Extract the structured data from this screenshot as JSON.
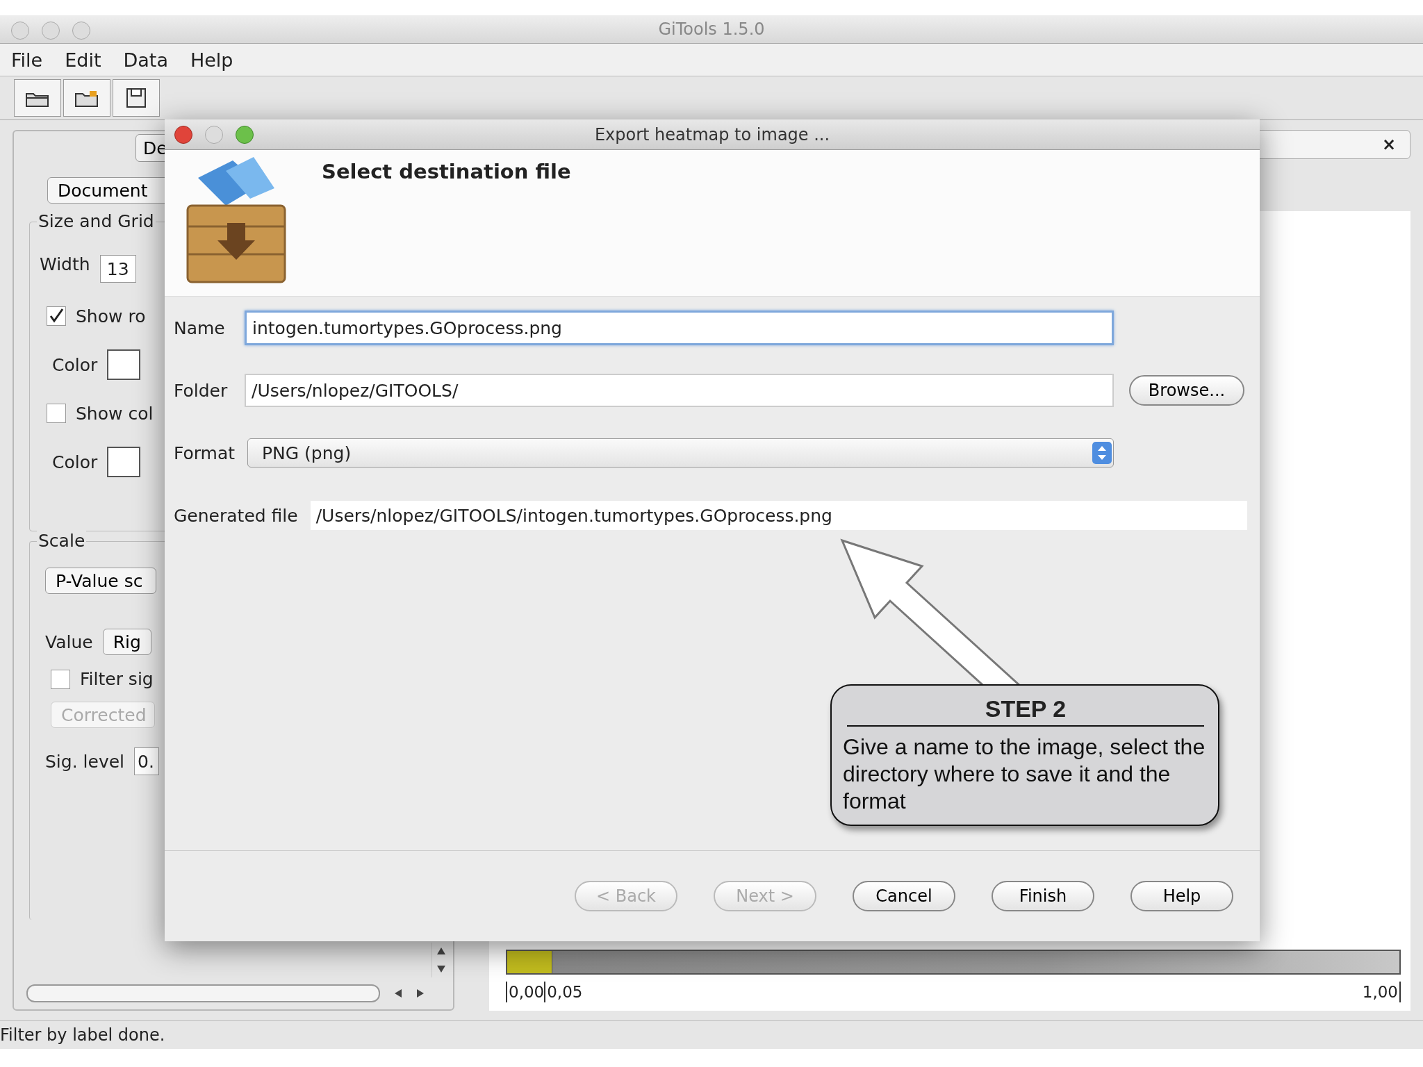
{
  "window": {
    "title": "GiTools 1.5.0"
  },
  "menu": [
    "File",
    "Edit",
    "Data",
    "Help"
  ],
  "left_panel": {
    "tab": "De",
    "document_button": "Document",
    "size_group": {
      "title": "Size and Grid",
      "width_label": "Width",
      "width_value": "13",
      "rows": [
        {
          "kind": "checkbox",
          "label": "Show ro",
          "checked": true
        },
        {
          "kind": "color",
          "label": "Color"
        },
        {
          "kind": "checkbox",
          "label": "Show col",
          "checked": false
        },
        {
          "kind": "color",
          "label": "Color"
        }
      ]
    },
    "scale_group": {
      "title": "Scale",
      "scale_button": "P-Value sc",
      "value_label": "Value",
      "value_button": "Rig",
      "filter": {
        "label": "Filter sig",
        "checked": false
      },
      "corrected_button": {
        "label": "Corrected",
        "disabled": true
      },
      "sig_label": "Sig. level",
      "sig_value": "0."
    }
  },
  "heatmap_panel": {
    "close": "×",
    "scale_labels": [
      "0,00",
      "0,05",
      "1,00"
    ]
  },
  "dialog": {
    "title": "Export heatmap to image ...",
    "heading": "Select destination file",
    "fields": [
      {
        "kind": "text",
        "label": "Name",
        "value": "intogen.tumortypes.GOprocess.png",
        "focused": true
      },
      {
        "kind": "text",
        "label": "Folder",
        "value": "/Users/nlopez/GITOOLS/",
        "focused": false,
        "button": "Browse..."
      },
      {
        "kind": "select",
        "label": "Format",
        "value": "PNG (png)"
      },
      {
        "kind": "readonly",
        "label": "Generated file",
        "value": "/Users/nlopez/GITOOLS/intogen.tumortypes.GOprocess.png"
      }
    ],
    "buttons": [
      {
        "label": "< Back",
        "disabled": true
      },
      {
        "label": "Next >",
        "disabled": true
      },
      {
        "label": "Cancel",
        "disabled": false
      },
      {
        "label": "Finish",
        "disabled": false
      },
      {
        "label": "Help",
        "disabled": false
      }
    ]
  },
  "callout": {
    "title": "STEP 2",
    "text": "Give a name to the image, select the directory where to save it and the format"
  },
  "status_bar": "Filter by label done."
}
